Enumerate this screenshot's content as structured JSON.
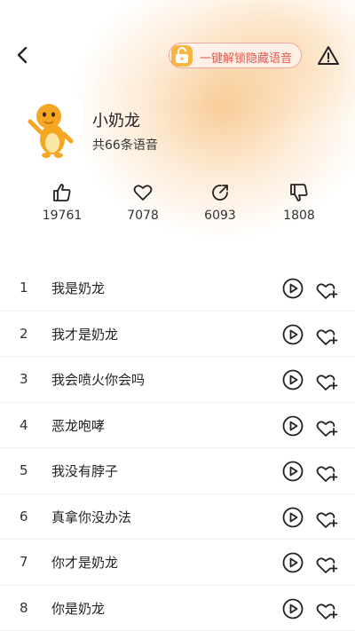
{
  "header": {
    "unlock_label": "一键解锁隐藏语音"
  },
  "profile": {
    "title": "小奶龙",
    "subtitle": "共66条语音"
  },
  "stats": [
    {
      "icon": "thumbs-up-icon",
      "value": "19761"
    },
    {
      "icon": "heart-icon",
      "value": "7078"
    },
    {
      "icon": "share-icon",
      "value": "6093"
    },
    {
      "icon": "thumbs-down-icon",
      "value": "1808"
    }
  ],
  "list": [
    {
      "index": "1",
      "name": "我是奶龙"
    },
    {
      "index": "2",
      "name": "我才是奶龙"
    },
    {
      "index": "3",
      "name": "我会喷火你会吗"
    },
    {
      "index": "4",
      "name": "恶龙咆哮"
    },
    {
      "index": "5",
      "name": "我没有脖子"
    },
    {
      "index": "6",
      "name": "真拿你没办法"
    },
    {
      "index": "7",
      "name": "你才是奶龙"
    },
    {
      "index": "8",
      "name": "你是奶龙"
    }
  ],
  "colors": {
    "accent": "#e05a4e",
    "header_glow": "#f7c486",
    "mascot": "#f5a623"
  }
}
